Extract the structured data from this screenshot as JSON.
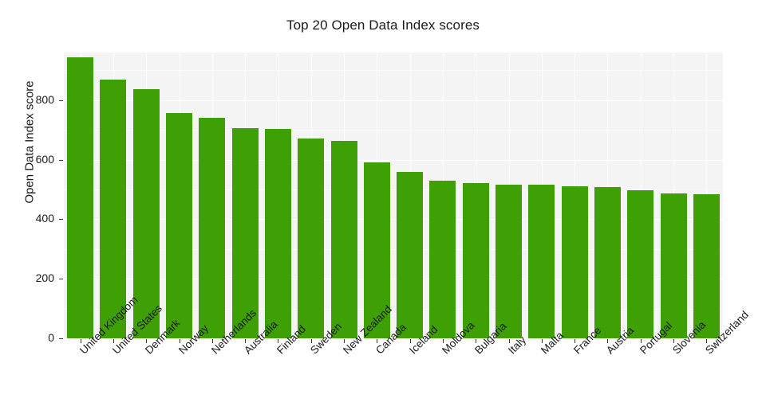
{
  "chart_data": {
    "type": "bar",
    "title": "Top 20 Open Data Index scores",
    "xlabel": "",
    "ylabel": "Open Data Index score",
    "ylim": [
      0,
      960
    ],
    "yticks": [
      0,
      200,
      400,
      600,
      800
    ],
    "ytick_labels": [
      "0",
      "200",
      "400",
      "600",
      "800"
    ],
    "grid": true,
    "legend": null,
    "bar_color": "#3ea004",
    "panel_background": "#f4f4f4",
    "gridline_color": "#ffffff",
    "categories": [
      "United Kingdom",
      "United States",
      "Denmark",
      "Norway",
      "Netherlands",
      "Australia",
      "Finland",
      "Sweden",
      "New Zealand",
      "Canada",
      "Iceland",
      "Moldova",
      "Bulgaria",
      "Italy",
      "Malta",
      "France",
      "Austria",
      "Portugal",
      "Slovenia",
      "Switzerland"
    ],
    "values": [
      945,
      870,
      837,
      756,
      742,
      707,
      703,
      672,
      662,
      590,
      560,
      530,
      522,
      517,
      516,
      512,
      507,
      497,
      488,
      483
    ]
  }
}
